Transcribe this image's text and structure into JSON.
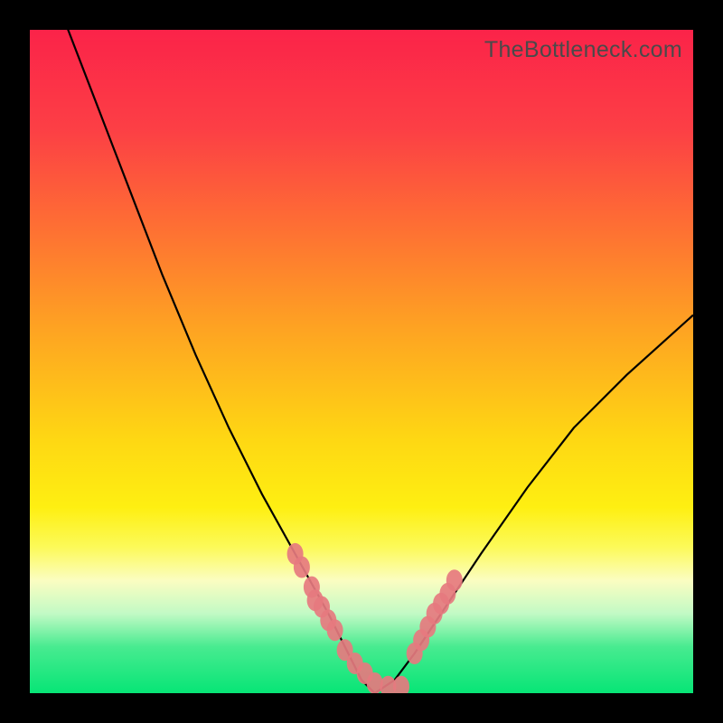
{
  "watermark": "TheBottleneck.com",
  "chart_data": {
    "type": "line",
    "title": "",
    "xlabel": "",
    "ylabel": "",
    "xlim": [
      0,
      100
    ],
    "ylim": [
      0,
      100
    ],
    "series": [
      {
        "name": "left-curve",
        "x": [
          5,
          10,
          15,
          20,
          25,
          30,
          35,
          40,
          45,
          48,
          50,
          52
        ],
        "values": [
          102,
          89,
          76,
          63,
          51,
          40,
          30,
          21,
          12,
          6,
          2,
          0
        ]
      },
      {
        "name": "right-curve",
        "x": [
          52,
          55,
          58,
          62,
          68,
          75,
          82,
          90,
          100
        ],
        "values": [
          0,
          2,
          6,
          12,
          21,
          31,
          40,
          48,
          57
        ]
      }
    ],
    "markers": [
      {
        "name": "left-cluster",
        "x": [
          40,
          41,
          42.5,
          43,
          44,
          45,
          46,
          47.5,
          49,
          50.5,
          52,
          54,
          56
        ],
        "values": [
          21,
          19,
          16,
          14,
          13,
          11,
          9.5,
          6.5,
          4.5,
          3,
          1.5,
          1,
          1
        ]
      },
      {
        "name": "right-cluster",
        "x": [
          58,
          59,
          60,
          61,
          62,
          63,
          64
        ],
        "values": [
          6,
          8,
          10,
          12,
          13.5,
          15,
          17
        ]
      }
    ],
    "colors": {
      "curve": "#000000",
      "marker_fill": "#e67a7f",
      "marker_stroke": "#e67a7f"
    }
  }
}
